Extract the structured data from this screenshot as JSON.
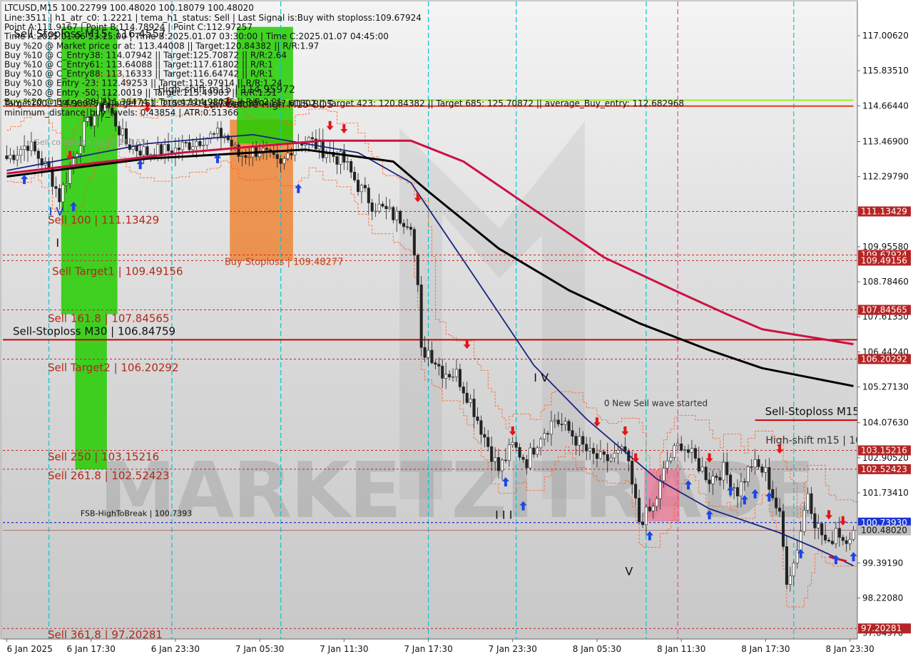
{
  "header": {
    "symbol_line": "LTCUSD,M15  100.22799 100.48020 100.18079 100.48020",
    "info_lines": [
      "Line:3511 | h1_atr_c0: 1.2221 | tema_h1_status: Sell | Last Signal is:Buy with stoploss:109.67924",
      "Point A:111.9167 | Point B:114.78924 | Point C:112.97257",
      "Time A:2025.01.06 23:15:00 | Time B:2025.01.07 03:30:00 | Time C:2025.01.07 04:45:00",
      "Buy %20 @ Market price or at: 113.44008 || Target:120.84382 || R/R:1.97",
      "Buy %10 @ C_Entry38: 114.07942 || Target:125.70872 || R/R:2.64",
      "Buy %10 @ C_Entry61: 113.64088 || Target:117.61802 || R/R:1",
      "Buy %10 @ C_Entry88: 113.16333 || Target:116.64742 || R/R:1",
      "Buy %10 @ Entry -23: 112.49253 || Target:115.97914 || R/R:1.24",
      "Buy %20 @ Entry -50: 112.0019 || Target:115.49903 || R/R:1.51",
      "Buy %20 @ Entry -88: 111.38474 || Target:114.98075 || R/R:2.21"
    ],
    "targets_line": "Target100: 114.98075 || Target 161: 115.97914 || Target 250: 117.61802 || Target 423: 120.84382 || Target 685: 125.70872 || average_Buy_entry: 112.682968",
    "min_distance_line": "minimum_distance_buy_levels: 0.43854 | ATR:0.51366"
  },
  "watermark": "MARKETZITRADE",
  "chart_data": {
    "type": "candlestick",
    "symbol": "LTCUSD",
    "timeframe": "M15",
    "ylim": [
      96.85,
      118.15
    ],
    "y_ticks": [
      117.0062,
      115.8351,
      114.6644,
      113.469,
      112.2979,
      109.9558,
      108.7846,
      107.6135,
      106.4424,
      105.2713,
      104.0763,
      102.9052,
      101.7341,
      99.3919,
      98.2208,
      97.049
    ],
    "y_tick_labels": [
      "117.00620",
      "115.83510",
      "114.66440",
      "113.46900",
      "112.29790",
      "109.95580",
      "108.78460",
      "107.61350",
      "106.44240",
      "105.27130",
      "104.07630",
      "102.90520",
      "101.73410",
      "99.39190",
      "98.22080",
      "97.04970"
    ],
    "x_labels": [
      "6 Jan 2025",
      "6 Jan 17:30",
      "6 Jan 23:30",
      "7 Jan 05:30",
      "7 Jan 11:30",
      "7 Jan 17:30",
      "7 Jan 23:30",
      "8 Jan 05:30",
      "8 Jan 11:30",
      "8 Jan 17:30",
      "8 Jan 23:30"
    ],
    "x_label_index": [
      0,
      24,
      48,
      72,
      96,
      120,
      144,
      168,
      192,
      216,
      240
    ],
    "bar_count": 242,
    "close_path": [
      [
        0,
        112.9
      ],
      [
        6,
        113.4
      ],
      [
        12,
        112.5
      ],
      [
        15,
        111.6
      ],
      [
        22,
        113.9
      ],
      [
        28,
        114.8
      ],
      [
        34,
        113.4
      ],
      [
        40,
        113.1
      ],
      [
        48,
        113.2
      ],
      [
        56,
        113.6
      ],
      [
        62,
        113.7
      ],
      [
        66,
        113.0
      ],
      [
        72,
        113.2
      ],
      [
        78,
        112.6
      ],
      [
        82,
        113.5
      ],
      [
        86,
        113.5
      ],
      [
        90,
        113.2
      ],
      [
        96,
        112.8
      ],
      [
        100,
        112.0
      ],
      [
        104,
        111.4
      ],
      [
        110,
        111.0
      ],
      [
        115,
        110.8
      ],
      [
        117,
        108.5
      ],
      [
        118,
        106.4
      ],
      [
        120,
        106.5
      ],
      [
        124,
        105.8
      ],
      [
        128,
        105.7
      ],
      [
        132,
        104.8
      ],
      [
        136,
        103.6
      ],
      [
        140,
        102.5
      ],
      [
        144,
        103.3
      ],
      [
        148,
        102.8
      ],
      [
        152,
        103.7
      ],
      [
        156,
        104.2
      ],
      [
        160,
        103.8
      ],
      [
        166,
        103.0
      ],
      [
        170,
        102.8
      ],
      [
        176,
        103.1
      ],
      [
        180,
        100.8
      ],
      [
        184,
        101.2
      ],
      [
        188,
        102.8
      ],
      [
        192,
        103.4
      ],
      [
        196,
        102.8
      ],
      [
        200,
        102.2
      ],
      [
        204,
        102.5
      ],
      [
        208,
        101.8
      ],
      [
        212,
        102.7
      ],
      [
        216,
        102.4
      ],
      [
        220,
        100.9
      ],
      [
        222,
        98.9
      ],
      [
        224,
        99.4
      ],
      [
        226,
        100.5
      ],
      [
        228,
        101.8
      ],
      [
        230,
        100.8
      ],
      [
        234,
        99.9
      ],
      [
        236,
        100.6
      ],
      [
        238,
        100.2
      ],
      [
        241,
        100.48
      ]
    ],
    "moving_averages": [
      {
        "color": "#1a237e",
        "points": [
          [
            0,
            112.5
          ],
          [
            40,
            113.4
          ],
          [
            70,
            113.7
          ],
          [
            100,
            113.1
          ],
          [
            115,
            112.1
          ],
          [
            130,
            109.5
          ],
          [
            150,
            106.0
          ],
          [
            165,
            104.2
          ],
          [
            185,
            102.2
          ],
          [
            200,
            101.2
          ],
          [
            220,
            100.4
          ],
          [
            230,
            99.9
          ],
          [
            241,
            99.3
          ]
        ]
      },
      {
        "color": "#000000",
        "points": [
          [
            0,
            112.3
          ],
          [
            40,
            112.9
          ],
          [
            85,
            113.2
          ],
          [
            110,
            112.8
          ],
          [
            120,
            111.8
          ],
          [
            140,
            109.9
          ],
          [
            160,
            108.5
          ],
          [
            180,
            107.4
          ],
          [
            200,
            106.5
          ],
          [
            215,
            105.9
          ],
          [
            241,
            105.3
          ]
        ]
      },
      {
        "color": "#cc1144",
        "points": [
          [
            0,
            112.4
          ],
          [
            50,
            113.1
          ],
          [
            90,
            113.5
          ],
          [
            115,
            113.5
          ],
          [
            130,
            112.8
          ],
          [
            150,
            111.2
          ],
          [
            170,
            109.6
          ],
          [
            190,
            108.5
          ],
          [
            205,
            107.7
          ],
          [
            215,
            107.2
          ],
          [
            241,
            106.7
          ]
        ]
      }
    ],
    "horizontal_levels": [
      {
        "value": 114.85,
        "color": "#99ee22",
        "label": "",
        "style": "solid",
        "from": 0,
        "to": 241
      },
      {
        "value": 114.6544,
        "color": "#e04020",
        "label": "",
        "style": "solid",
        "from": 0,
        "to": 241
      },
      {
        "value": 111.13429,
        "color": "#cc2222",
        "label": "Sell 100 | 111.13429",
        "style": "dashed",
        "from": 0,
        "to": 242
      },
      {
        "value": 109.6792,
        "color": "#cc2222",
        "label": "",
        "style": "dashed",
        "from": 0,
        "to": 242
      },
      {
        "value": 109.49156,
        "color": "#cc2222",
        "label": "Sell Target1 | 109.49156",
        "style": "dashed",
        "from": 0,
        "to": 242
      },
      {
        "value": 107.84565,
        "color": "#cc2222",
        "label": "Sell 161.8 | 107.84565",
        "style": "dashed",
        "from": 0,
        "to": 242
      },
      {
        "value": 106.84759,
        "color": "#cc0000",
        "label": "Sell-Stoploss M30 | 106.84759",
        "style": "solid",
        "from": 0,
        "to": 242
      },
      {
        "value": 106.20292,
        "color": "#cc2222",
        "label": "Sell Target2 | 106.20292",
        "style": "dashed",
        "from": 0,
        "to": 242
      },
      {
        "value": 104.16248,
        "color": "#cc0000",
        "label": "Sell-Stoploss M15 | 104.16248",
        "style": "solid",
        "from": 213,
        "to": 242
      },
      {
        "value": 103.15216,
        "color": "#cc2222",
        "label": "Sell 250 | 103.15216",
        "style": "dashed",
        "from": 0,
        "to": 242
      },
      {
        "value": 102.52423,
        "color": "#cc2222",
        "label": "Sell 261.8 | 102.52423",
        "style": "dashed",
        "from": 0,
        "to": 242
      },
      {
        "value": 100.7393,
        "color": "#0000cc",
        "label": "FSB-HighToBreak | 100.7393",
        "style": "dashed",
        "from": 0,
        "to": 242
      },
      {
        "value": 97.20281,
        "color": "#cc2222",
        "label": "Sell 361.8 | 97.20281",
        "style": "dashed",
        "from": 0,
        "to": 242
      }
    ],
    "right_badges": [
      {
        "value": 111.13429,
        "text": "111.13429",
        "color": "#b52525"
      },
      {
        "value": 109.6792,
        "text": "109.67924",
        "color": "#b52525"
      },
      {
        "value": 109.49156,
        "text": "109.49156",
        "color": "#b52525"
      },
      {
        "value": 107.84565,
        "text": "107.84565",
        "color": "#b52525"
      },
      {
        "value": 106.20292,
        "text": "106.20292",
        "color": "#b52525"
      },
      {
        "value": 103.15216,
        "text": "103.15216",
        "color": "#b52525"
      },
      {
        "value": 102.52423,
        "text": "102.52423",
        "color": "#b52525"
      },
      {
        "value": 100.7393,
        "text": "100.73930",
        "color": "#1a35d6"
      },
      {
        "value": 100.4802,
        "text": "100.48020",
        "color": "#bdbdbd"
      },
      {
        "value": 97.20281,
        "text": "97.20281",
        "color": "#b52525"
      }
    ],
    "annotations": [
      {
        "text": "Buy Stoploss | 109.48277",
        "x": 62,
        "y": 109.35,
        "color": "#c84010",
        "size": 13
      },
      {
        "text": "Sell correction 38.2 | 113.55",
        "x": 8,
        "y": 113.36,
        "color": "#999999",
        "size": 11
      },
      {
        "text": "High-shift m15 | 103.02154",
        "x": 216,
        "y": 103.38,
        "color": "#333333",
        "size": 14
      },
      {
        "text": "0 New Sell wave started",
        "x": 170,
        "y": 104.63,
        "color": "#333333",
        "size": 12
      },
      {
        "text": "I V",
        "x": 12,
        "y": 111.0,
        "color": "#1030c0",
        "size": 16
      },
      {
        "text": "I",
        "x": 14,
        "y": 109.95,
        "color": "#111111",
        "size": 16
      },
      {
        "text": "I V",
        "x": 150,
        "y": 105.45,
        "color": "#111111",
        "size": 16
      },
      {
        "text": "I I I",
        "x": 139,
        "y": 100.86,
        "color": "#111111",
        "size": 16
      },
      {
        "text": "V",
        "x": 176,
        "y": 98.98,
        "color": "#111111",
        "size": 16
      },
      {
        "text": "Sell Stoploss M15: 116.4557",
        "x": 2,
        "y": 116.95,
        "color": "#111111",
        "size": 15
      },
      {
        "text": "High-shift m15 | 114.95972",
        "x": 43,
        "y": 115.1,
        "color": "#222222",
        "size": 14
      },
      {
        "text": "Low before High M15-BOS",
        "x": 56,
        "y": 114.6,
        "color": "#222222",
        "size": 14
      },
      {
        "text": "FSB-HighToBreak | 100.7393",
        "x": 21,
        "y": 100.96,
        "color": "#111111",
        "size": 11
      }
    ],
    "zones": [
      {
        "from": 16,
        "to": 32,
        "y1": 117.3,
        "y2": 107.7,
        "color": "#22cc00",
        "opacity": 0.85
      },
      {
        "from": 20,
        "to": 29,
        "y1": 107.7,
        "y2": 102.52,
        "color": "#22cc00",
        "opacity": 0.85
      },
      {
        "from": 64,
        "to": 82,
        "y1": 114.2,
        "y2": 109.5,
        "color": "#f07820",
        "opacity": 0.75
      },
      {
        "from": 66,
        "to": 82,
        "y1": 117.3,
        "y2": 113.4,
        "color": "#22cc00",
        "opacity": 0.85
      },
      {
        "from": 182,
        "to": 192,
        "y1": 102.5,
        "y2": 100.78,
        "color": "#ee7090",
        "opacity": 0.7
      }
    ],
    "vertical_lines": [
      {
        "x": 12,
        "color": "#00c8d8"
      },
      {
        "x": 47,
        "color": "#00c8d8"
      },
      {
        "x": 78,
        "color": "#00c8d8"
      },
      {
        "x": 120,
        "color": "#00c8d8"
      },
      {
        "x": 145,
        "color": "#00c8d8"
      },
      {
        "x": 182,
        "color": "#00c8d8"
      },
      {
        "x": 224,
        "color": "#00c8d8"
      },
      {
        "x": 191,
        "color": "#ee44aa"
      }
    ],
    "arrows_up": [
      [
        5,
        112.5
      ],
      [
        19,
        111.6
      ],
      [
        38,
        113.0
      ],
      [
        60,
        113.2
      ],
      [
        83,
        112.2
      ],
      [
        142,
        102.4
      ],
      [
        147,
        101.6
      ],
      [
        183,
        100.6
      ],
      [
        194,
        102.3
      ],
      [
        200,
        101.3
      ],
      [
        206,
        102.1
      ],
      [
        210,
        101.8
      ],
      [
        213,
        102.0
      ],
      [
        217,
        101.9
      ],
      [
        226,
        100.0
      ],
      [
        236,
        99.8
      ],
      [
        241,
        99.9
      ]
    ],
    "arrows_down": [
      [
        18,
        112.7
      ],
      [
        40,
        114.3
      ],
      [
        63,
        114.5
      ],
      [
        92,
        113.7
      ],
      [
        96,
        113.6
      ],
      [
        117,
        111.3
      ],
      [
        131,
        106.4
      ],
      [
        144,
        103.5
      ],
      [
        168,
        103.8
      ],
      [
        176,
        103.5
      ],
      [
        179,
        102.6
      ],
      [
        200,
        102.6
      ],
      [
        220,
        102.9
      ],
      [
        234,
        100.7
      ],
      [
        238,
        100.5
      ]
    ],
    "ytick_grid": true
  }
}
